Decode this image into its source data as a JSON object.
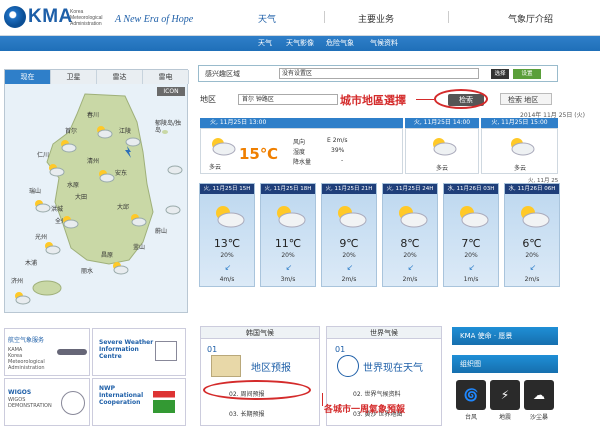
{
  "header": {
    "logo": "KMA",
    "logo_sub": "Korea Meteorological Administration",
    "slogan": "A New Era of Hope",
    "nav": [
      "天气",
      "主要业务",
      "气象厅介绍"
    ],
    "subnav": [
      "天气",
      "天气影像",
      "危险气象",
      "气候资料"
    ]
  },
  "map": {
    "tabs": [
      "现在",
      "卫星",
      "雷达",
      "雷电"
    ],
    "icon_button": "ICON",
    "cities": [
      "春川",
      "江陵",
      "郁陵岛/独岛",
      "首尔",
      "仁川",
      "清州",
      "安东",
      "水原",
      "大田",
      "洪城",
      "瑞山",
      "全州",
      "大邱",
      "光州",
      "昌原",
      "蔚山",
      "釜山",
      "丽水",
      "济州",
      "木浦"
    ]
  },
  "left_links": [
    {
      "title": "航空气象服务",
      "sub": "KAMA\nKorea Meteorological Administration"
    },
    {
      "title": "Severe Weather\nInformation\nCentre",
      "sub": ""
    },
    {
      "title": "WIGOS",
      "sub": "WIGOS\nDEMONSTRATION"
    },
    {
      "title": "NWP\nInternational\nCooperation",
      "sub": ""
    }
  ],
  "search": {
    "label": "感兴趣区域",
    "select": "没有设置区",
    "btn_confirm": "选择",
    "btn_set": "设置",
    "region_label": "地区",
    "region_value": "首尔 钟路区",
    "search_btn": "检索",
    "region_search": "检索 地区",
    "annotation_map": "城市地區選擇"
  },
  "current": {
    "head_now": "火, 11月25日 13:00",
    "datetime": "2014年 11月 25日 (火) 13:30",
    "head_14": "火, 11月25日 14:00",
    "head_15": "火, 11月25日 15:00",
    "condition": "多云",
    "temp": "15℃",
    "wind_label": "风向",
    "wind_value": "E 2m/s",
    "humidity_label": "湿度",
    "humidity_value": "39%",
    "rain_label": "降水量",
    "rain_value": "-",
    "cond_14": "多云",
    "cond_15": "多云",
    "mini_label": "火, 11月 25"
  },
  "forecast": [
    {
      "head": "火, 11月25日 15H",
      "temp": "13℃",
      "pop": "20%",
      "wind": "4m/s"
    },
    {
      "head": "火, 11月25日 18H",
      "temp": "11℃",
      "pop": "20%",
      "wind": "3m/s"
    },
    {
      "head": "火, 11月25日 21H",
      "temp": "9℃",
      "pop": "20%",
      "wind": "2m/s"
    },
    {
      "head": "火, 11月25日 24H",
      "temp": "8℃",
      "pop": "20%",
      "wind": "2m/s"
    },
    {
      "head": "水, 11月26日 03H",
      "temp": "7℃",
      "pop": "20%",
      "wind": "1m/s"
    },
    {
      "head": "水, 11月26日 06H",
      "temp": "6℃",
      "pop": "20%",
      "wind": "2m/s"
    }
  ],
  "korea_box": {
    "head": "韩国气候",
    "num": "01",
    "big": "地区预报",
    "item2": "02. 周间预报",
    "item3": "03. 长期预报"
  },
  "world_box": {
    "head": "世界气候",
    "num": "01",
    "big": "世界现在天气",
    "item2": "02. 世界气候资料",
    "item3": "03. 黄沙 世界地图"
  },
  "annotation_week": "各城市一周氣象預報",
  "kma_mission": "KMA 使命 · 愿景",
  "photo_title": "组织图",
  "disasters": [
    "台风",
    "地震",
    "沙尘暴"
  ],
  "colors": {
    "primary": "#2f7fc9",
    "accent": "#ef7f00",
    "annotation": "#d42b2b"
  }
}
